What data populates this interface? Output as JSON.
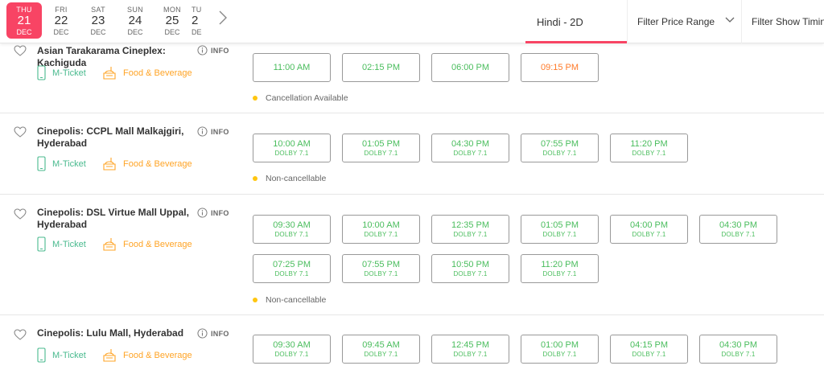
{
  "dates": [
    {
      "dow": "THU",
      "day": "21",
      "mon": "DEC",
      "active": true
    },
    {
      "dow": "FRI",
      "day": "22",
      "mon": "DEC",
      "active": false
    },
    {
      "dow": "SAT",
      "day": "23",
      "mon": "DEC",
      "active": false
    },
    {
      "dow": "SUN",
      "day": "24",
      "mon": "DEC",
      "active": false
    },
    {
      "dow": "MON",
      "day": "25",
      "mon": "DEC",
      "active": false
    },
    {
      "dow": "TU",
      "day": "2",
      "mon": "DE",
      "active": false
    }
  ],
  "filters": {
    "language": "Hindi - 2D",
    "price": "Filter Price Range",
    "timings": "Filter Show Timings"
  },
  "colors": {
    "accent": "#f84464",
    "available": "#4abd5d",
    "fast_filling": "#ff7a29",
    "mticket": "#49ba8e",
    "food": "#ffa426",
    "note_dot": "#ffc610"
  },
  "venues": [
    {
      "name": "Asian Tarakarama Cineplex: Kachiguda",
      "info": "INFO",
      "mticket": "M-Ticket",
      "food": "Food & Beverage",
      "note": "Cancellation Available",
      "showtimes": [
        {
          "time": "11:00 AM",
          "format": "",
          "status": "available"
        },
        {
          "time": "02:15 PM",
          "format": "",
          "status": "available"
        },
        {
          "time": "06:00 PM",
          "format": "",
          "status": "available"
        },
        {
          "time": "09:15 PM",
          "format": "",
          "status": "fast-filling"
        }
      ]
    },
    {
      "name": "Cinepolis: CCPL Mall Malkajgiri, Hyderabad",
      "info": "INFO",
      "mticket": "M-Ticket",
      "food": "Food & Beverage",
      "note": "Non-cancellable",
      "showtimes": [
        {
          "time": "10:00 AM",
          "format": "DOLBY 7.1",
          "status": "available"
        },
        {
          "time": "01:05 PM",
          "format": "DOLBY 7.1",
          "status": "available"
        },
        {
          "time": "04:30 PM",
          "format": "DOLBY 7.1",
          "status": "available"
        },
        {
          "time": "07:55 PM",
          "format": "DOLBY 7.1",
          "status": "available"
        },
        {
          "time": "11:20 PM",
          "format": "DOLBY 7.1",
          "status": "available"
        }
      ]
    },
    {
      "name": "Cinepolis: DSL Virtue Mall Uppal, Hyderabad",
      "info": "INFO",
      "mticket": "M-Ticket",
      "food": "Food & Beverage",
      "note": "Non-cancellable",
      "showtimes": [
        {
          "time": "09:30 AM",
          "format": "DOLBY 7.1",
          "status": "available"
        },
        {
          "time": "10:00 AM",
          "format": "DOLBY 7.1",
          "status": "available"
        },
        {
          "time": "12:35 PM",
          "format": "DOLBY 7.1",
          "status": "available"
        },
        {
          "time": "01:05 PM",
          "format": "DOLBY 7.1",
          "status": "available"
        },
        {
          "time": "04:00 PM",
          "format": "DOLBY 7.1",
          "status": "available"
        },
        {
          "time": "04:30 PM",
          "format": "DOLBY 7.1",
          "status": "available"
        },
        {
          "time": "07:25 PM",
          "format": "DOLBY 7.1",
          "status": "available"
        },
        {
          "time": "07:55 PM",
          "format": "DOLBY 7.1",
          "status": "available"
        },
        {
          "time": "10:50 PM",
          "format": "DOLBY 7.1",
          "status": "available"
        },
        {
          "time": "11:20 PM",
          "format": "DOLBY 7.1",
          "status": "available"
        }
      ]
    },
    {
      "name": "Cinepolis: Lulu Mall, Hyderabad",
      "info": "INFO",
      "mticket": "M-Ticket",
      "food": "Food & Beverage",
      "note": "",
      "showtimes": [
        {
          "time": "09:30 AM",
          "format": "DOLBY 7.1",
          "status": "available"
        },
        {
          "time": "09:45 AM",
          "format": "DOLBY 7.1",
          "status": "available"
        },
        {
          "time": "12:45 PM",
          "format": "DOLBY 7.1",
          "status": "available"
        },
        {
          "time": "01:00 PM",
          "format": "DOLBY 7.1",
          "status": "available"
        },
        {
          "time": "04:15 PM",
          "format": "DOLBY 7.1",
          "status": "available"
        },
        {
          "time": "04:30 PM",
          "format": "DOLBY 7.1",
          "status": "available"
        }
      ]
    }
  ]
}
